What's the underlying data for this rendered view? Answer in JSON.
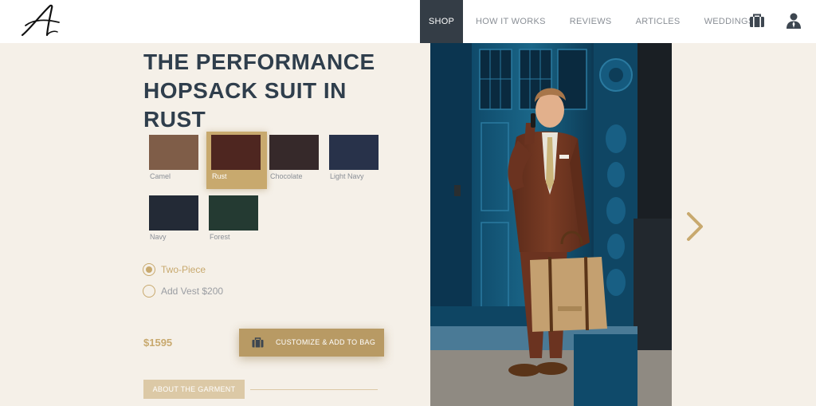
{
  "header": {
    "logo_alt": "A",
    "nav": [
      {
        "label": "SHOP",
        "active": true
      },
      {
        "label": "HOW IT WORKS",
        "active": false
      },
      {
        "label": "REVIEWS",
        "active": false
      },
      {
        "label": "ARTICLES",
        "active": false
      },
      {
        "label": "WEDDINGS",
        "active": false
      }
    ],
    "icons": [
      "bag-icon",
      "account-icon"
    ]
  },
  "product": {
    "title_line1": "THE PERFORMANCE",
    "title_line2": "HOPSACK SUIT IN RUST",
    "swatches": [
      {
        "label": "Camel",
        "color": "#7f5d48",
        "selected": false
      },
      {
        "label": "Rust",
        "color": "#4e2620",
        "selected": true
      },
      {
        "label": "Chocolate",
        "color": "#36292a",
        "selected": false
      },
      {
        "label": "Light Navy",
        "color": "#28324a",
        "selected": false
      },
      {
        "label": "Navy",
        "color": "#232a36",
        "selected": false
      },
      {
        "label": "Forest",
        "color": "#243a32",
        "selected": false
      }
    ],
    "options": [
      {
        "label": "Two-Piece",
        "checked": true
      },
      {
        "label": "Add Vest $200",
        "checked": false
      }
    ],
    "price": "$1595",
    "add_button_label": "CUSTOMIZE & ADD TO BAG",
    "about_tab_label": "ABOUT THE GARMENT"
  },
  "colors": {
    "accent_gold": "#c8a96e",
    "nav_active": "#343d46",
    "page_bg": "#f5f0e8",
    "title_text": "#2f3e4c"
  }
}
